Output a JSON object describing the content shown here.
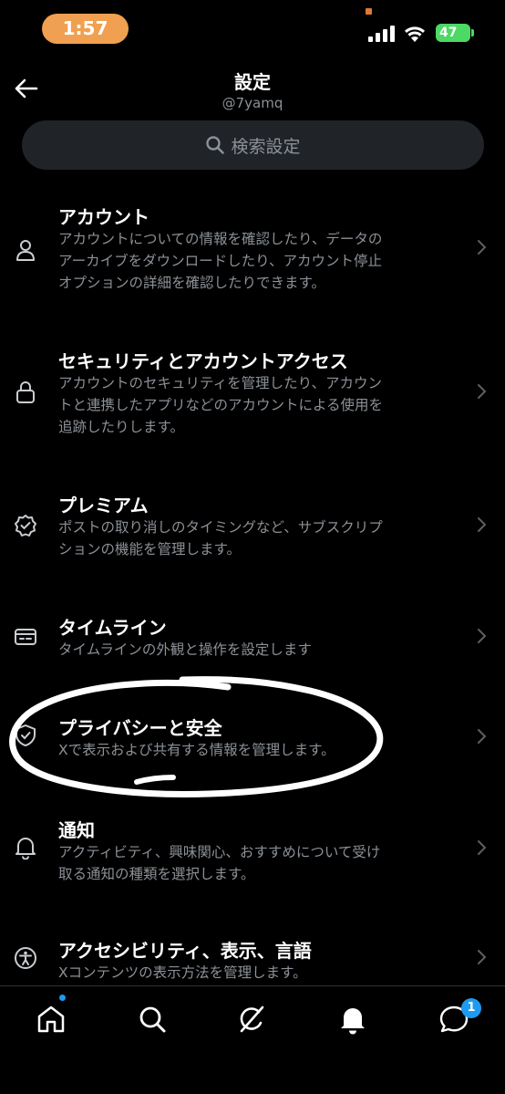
{
  "status_bar": {
    "time": "1:57",
    "battery": "47"
  },
  "header": {
    "title": "設定",
    "handle": "@7yamq"
  },
  "search": {
    "placeholder": "検索設定"
  },
  "settings": [
    {
      "title": "アカウント",
      "lines": [
        "アカウントについての情報を確認したり、データの",
        "アーカイブをダウンロードしたり、アカウント停止",
        "オプションの詳細を確認したりできます。"
      ],
      "icon": "person-icon"
    },
    {
      "title": "セキュリティとアカウントアクセス",
      "lines": [
        "アカウントのセキュリティを管理したり、アカウン",
        "トと連携したアプリなどのアカウントによる使用を",
        "追跡したりします。"
      ],
      "icon": "lock-icon"
    },
    {
      "title": "プレミアム",
      "lines": [
        "ポストの取り消しのタイミングなど、サブスクリプ",
        "ションの機能を管理します。"
      ],
      "icon": "verified-badge-icon"
    },
    {
      "title": "タイムライン",
      "lines": [
        "タイムラインの外観と操作を設定します"
      ],
      "icon": "timeline-icon"
    },
    {
      "title": "プライバシーと安全",
      "lines": [
        "Xで表示および共有する情報を管理します。"
      ],
      "icon": "shield-icon"
    },
    {
      "title": "通知",
      "lines": [
        "アクティビティ、興味関心、おすすめについて受け",
        "取る通知の種類を選択します。"
      ],
      "icon": "bell-icon"
    },
    {
      "title": "アクセシビリティ、表示、言語",
      "lines": [
        "Xコンテンツの表示方法を管理します。"
      ],
      "icon": "accessibility-icon"
    }
  ],
  "bottom_nav": {
    "messages_badge": "1"
  },
  "colors": {
    "background": "#000000",
    "secondary_text": "#8b9197",
    "accent": "#1d9bf0",
    "search_bg": "#202327"
  }
}
